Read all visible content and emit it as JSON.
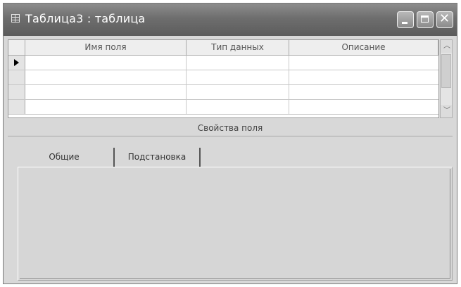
{
  "window": {
    "title": "Таблица3 : таблица",
    "icon": "table-icon",
    "buttons": {
      "minimize": "minimize-icon",
      "maximize": "maximize-icon",
      "close": "close-icon"
    }
  },
  "grid": {
    "columns": [
      "Имя поля",
      "Тип данных",
      "Описание"
    ],
    "rows": [
      {
        "field_name": "",
        "data_type": "",
        "description": "",
        "current": true
      },
      {
        "field_name": "",
        "data_type": "",
        "description": "",
        "current": false
      },
      {
        "field_name": "",
        "data_type": "",
        "description": "",
        "current": false
      },
      {
        "field_name": "",
        "data_type": "",
        "description": "",
        "current": false
      }
    ]
  },
  "properties": {
    "label": "Свойства поля",
    "tabs": [
      "Общие",
      "Подстановка"
    ]
  },
  "colors": {
    "titlebar": "#6e6e6e",
    "window_bg": "#d8d8d8",
    "grid_bg": "#ffffff"
  }
}
